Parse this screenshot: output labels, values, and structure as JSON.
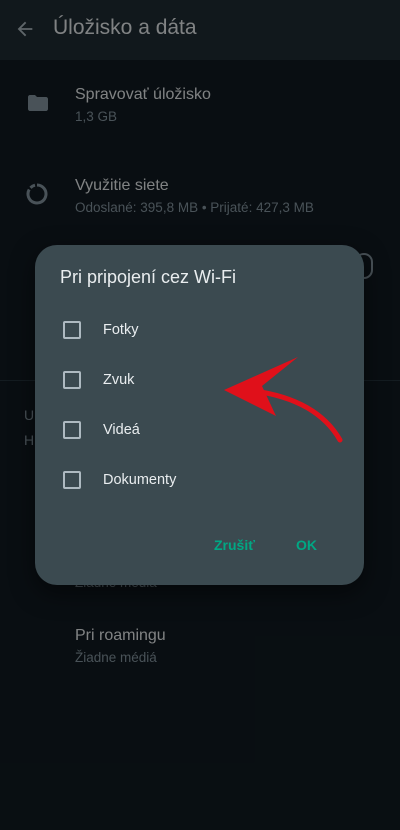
{
  "header": {
    "title": "Úložisko a dáta",
    "back_icon": "arrow-left-icon"
  },
  "items": [
    {
      "title": "Spravovať úložisko",
      "subtitle": "1,3 GB",
      "icon": "folder-icon"
    },
    {
      "title": "Využitie siete",
      "subtitle": "Odoslané: 395,8 MB • Prijaté: 427,3 MB",
      "icon": "data-usage-icon"
    }
  ],
  "background_peek": {
    "letter_1": "U",
    "letter_2": "H",
    "partial_subtitle": "Žiadne médiá"
  },
  "roaming": {
    "title": "Pri roamingu",
    "subtitle": "Žiadne médiá"
  },
  "dialog": {
    "title": "Pri pripojení cez Wi-Fi",
    "options": [
      {
        "label": "Fotky",
        "checked": false
      },
      {
        "label": "Zvuk",
        "checked": false
      },
      {
        "label": "Videá",
        "checked": false
      },
      {
        "label": "Dokumenty",
        "checked": false
      }
    ],
    "cancel_label": "Zrušiť",
    "ok_label": "OK"
  },
  "colors": {
    "accent": "#00a884",
    "annotation_arrow": "#e0101a",
    "dialog_bg": "#3b4a50"
  }
}
